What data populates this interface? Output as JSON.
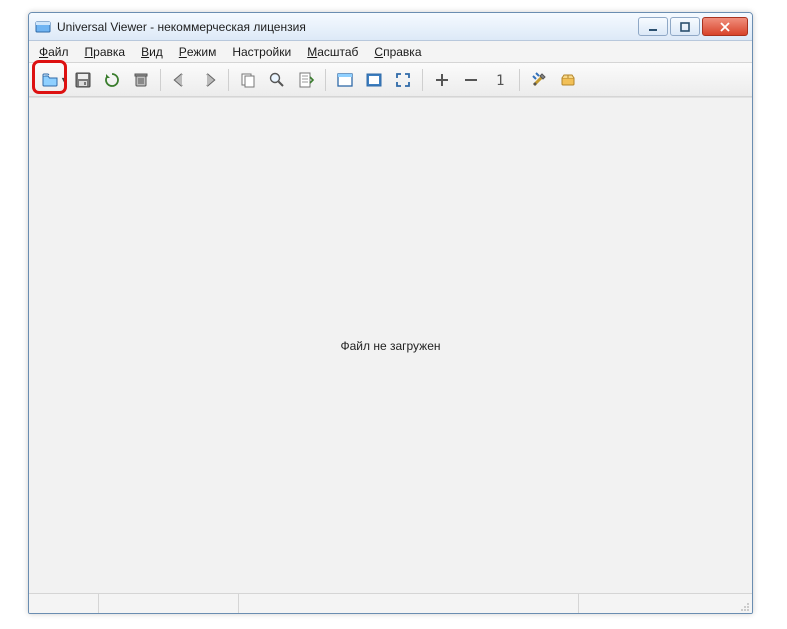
{
  "titlebar": {
    "title": "Universal Viewer - некоммерческая лицензия"
  },
  "menu": {
    "items": [
      {
        "label": "Файл",
        "u": 0
      },
      {
        "label": "Правка",
        "u": 0
      },
      {
        "label": "Вид",
        "u": 0
      },
      {
        "label": "Режим",
        "u": 0
      },
      {
        "label": "Настройки",
        "u": -1
      },
      {
        "label": "Масштаб",
        "u": 0
      },
      {
        "label": "Справка",
        "u": 0
      }
    ]
  },
  "toolbar": {
    "icons": [
      "open-file",
      "save",
      "reload",
      "delete",
      "|",
      "nav-back",
      "nav-forward",
      "|",
      "copy",
      "find",
      "goto-line",
      "|",
      "fit-window",
      "fit-width",
      "fullscreen",
      "|",
      "zoom-in",
      "zoom-out",
      "zoom-100",
      "|",
      "options",
      "plugins"
    ]
  },
  "content": {
    "message": "Файл не загружен"
  },
  "colors": {
    "accent": "#3d7fc1",
    "highlight": "#d11"
  }
}
